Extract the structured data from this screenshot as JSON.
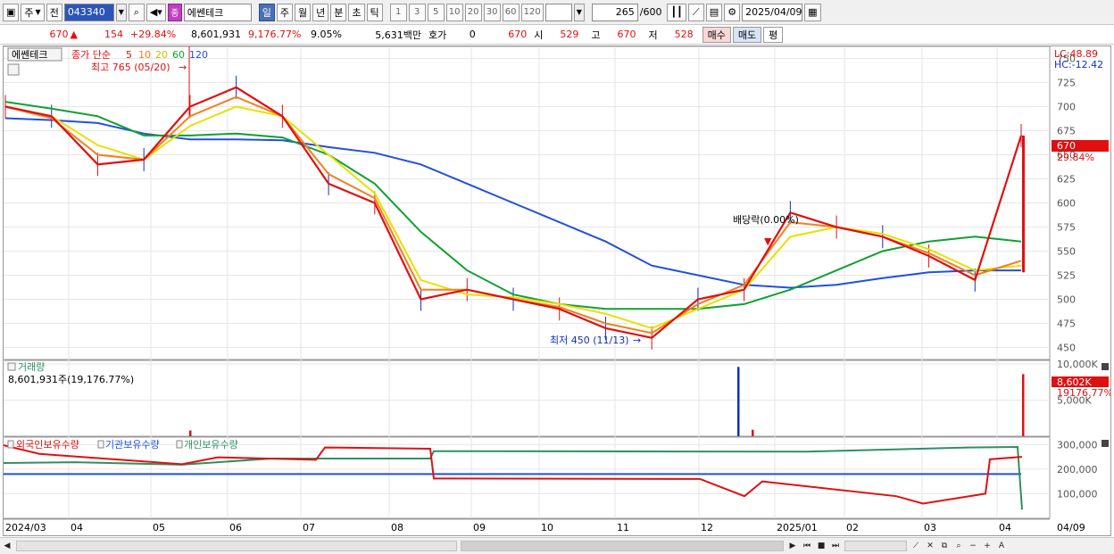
{
  "toolbar": {
    "market": "주",
    "prev_label": "전",
    "code": "043340",
    "name": "에쎈테크",
    "badge": "종",
    "periods": [
      "일",
      "주",
      "월",
      "년",
      "분",
      "초",
      "틱"
    ],
    "active_period": "일",
    "intervals": [
      "1",
      "3",
      "5",
      "10",
      "20",
      "30",
      "60",
      "120"
    ],
    "count": "265",
    "count_total": "/600",
    "date": "2025/04/09"
  },
  "quote": {
    "price": "670",
    "change": "154",
    "change_pct": "+29.84%",
    "volume": "8,601,931",
    "volume_pct": "9,176.77%",
    "turnover": "9.05%",
    "amount": "5,631백만",
    "hoga_label": "호가",
    "hoga_value": "0",
    "hoga_price": "670",
    "open_label": "시",
    "open": "529",
    "high_label": "고",
    "high": "670",
    "low_label": "저",
    "low": "528",
    "buy_label": "매수",
    "sell_label": "매도",
    "eval_label": "평"
  },
  "price_panel": {
    "title": "에쎈테크",
    "ma_label": "종가 단순",
    "ma_periods": [
      "5",
      "10",
      "20",
      "60",
      "120"
    ],
    "ma_colors": [
      "#e01010",
      "#f08020",
      "#e8e000",
      "#10a030",
      "#2050e0"
    ],
    "max_label": "최고 765 (05/20)",
    "min_label": "최저 450 (11/13)",
    "dividend_label": "배당락(0.00%)",
    "lc_label": "LC:48.89",
    "hc_label": "HC:-12.42",
    "last_price": "670",
    "last_pct": "29.84%",
    "y_ticks": [
      "750",
      "725",
      "700",
      "675",
      "650",
      "625",
      "600",
      "575",
      "550",
      "525",
      "500",
      "475",
      "450"
    ]
  },
  "volume_panel": {
    "title": "거래량",
    "value_label": "8,601,931주(19,176.77%)",
    "y_ticks": [
      "10,000K",
      "5,000K"
    ],
    "last_value": "8,602K",
    "last_pct": "19176.77%"
  },
  "holdings_panel": {
    "titles": [
      "외국인보유수량",
      "기관보유수량",
      "개인보유수량"
    ],
    "colors": [
      "#e01010",
      "#2050e0",
      "#2f9060"
    ],
    "y_ticks": [
      "300,000",
      "200,000",
      "100,000"
    ]
  },
  "x_axis": {
    "labels": [
      "2024/03",
      "04",
      "05",
      "06",
      "07",
      "08",
      "09",
      "10",
      "11",
      "12",
      "2025/01",
      "02",
      "03",
      "04"
    ],
    "last_label": "04/09"
  },
  "chart_data": {
    "type": "line",
    "price_ma": [
      {
        "name": "5",
        "color": "#e01010",
        "values": [
          700,
          690,
          640,
          645,
          700,
          720,
          690,
          620,
          600,
          500,
          510,
          500,
          490,
          470,
          460,
          500,
          510,
          590,
          575,
          565,
          545,
          520,
          670
        ]
      },
      {
        "name": "10",
        "color": "#f08020",
        "values": [
          700,
          688,
          650,
          645,
          690,
          710,
          690,
          630,
          605,
          510,
          510,
          500,
          492,
          475,
          465,
          495,
          515,
          580,
          575,
          565,
          548,
          525,
          540
        ]
      },
      {
        "name": "20",
        "color": "#e8e000",
        "values": [
          700,
          690,
          660,
          645,
          680,
          700,
          690,
          650,
          610,
          520,
          505,
          502,
          495,
          485,
          470,
          490,
          510,
          565,
          575,
          568,
          552,
          530,
          535
        ]
      },
      {
        "name": "60",
        "color": "#10a030",
        "values": [
          705,
          698,
          690,
          670,
          670,
          672,
          668,
          650,
          620,
          570,
          530,
          505,
          495,
          490,
          490,
          490,
          495,
          510,
          530,
          550,
          560,
          565,
          560
        ]
      },
      {
        "name": "120",
        "color": "#2050e0",
        "values": [
          688,
          686,
          683,
          672,
          666,
          666,
          665,
          658,
          652,
          640,
          620,
          600,
          580,
          560,
          535,
          525,
          515,
          512,
          515,
          522,
          528,
          530,
          530
        ]
      }
    ]
  }
}
